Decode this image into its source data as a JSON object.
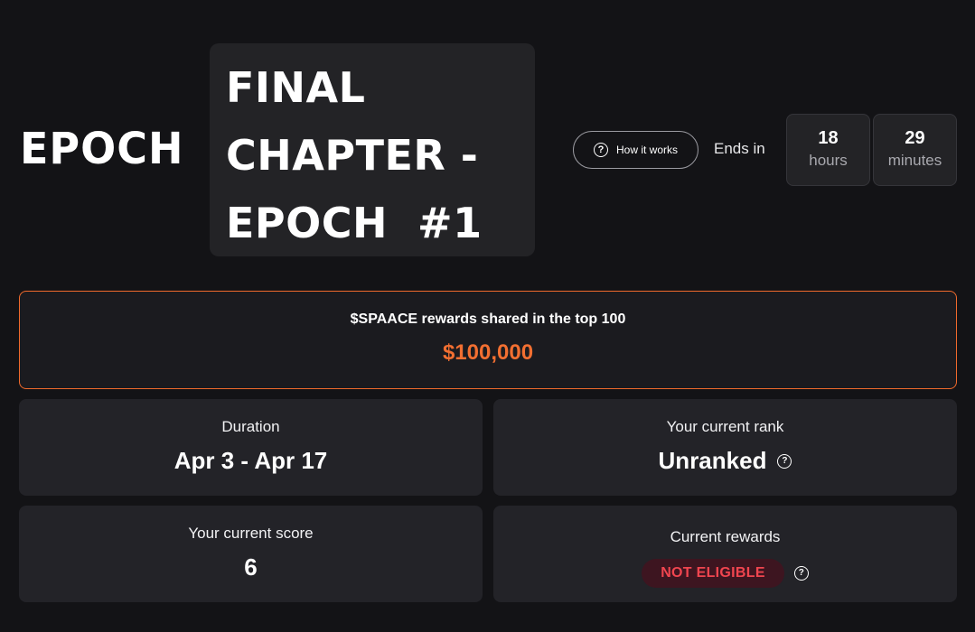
{
  "header": {
    "epoch_label": "EPOCH",
    "title_lines": [
      "FINAL",
      "CHAPTER -",
      "EPOCH  #1"
    ],
    "how_it_works_label": "How it works",
    "ends_in_label": "Ends in",
    "countdown": {
      "hours_value": "18",
      "hours_unit": "hours",
      "minutes_value": "29",
      "minutes_unit": "minutes"
    }
  },
  "rewards_banner": {
    "label": "$SPAACE rewards shared in the top 100",
    "amount": "$100,000",
    "accent_color": "#f26f31"
  },
  "stats": {
    "duration": {
      "label": "Duration",
      "value": "Apr 3 - Apr 17"
    },
    "rank": {
      "label": "Your current rank",
      "value": "Unranked"
    },
    "score": {
      "label": "Your current score",
      "value": "6"
    },
    "rewards": {
      "label": "Current rewards",
      "badge": "NOT ELIGIBLE",
      "badge_color": "#f0454f"
    }
  },
  "icons": {
    "help": "question-circle-icon"
  }
}
